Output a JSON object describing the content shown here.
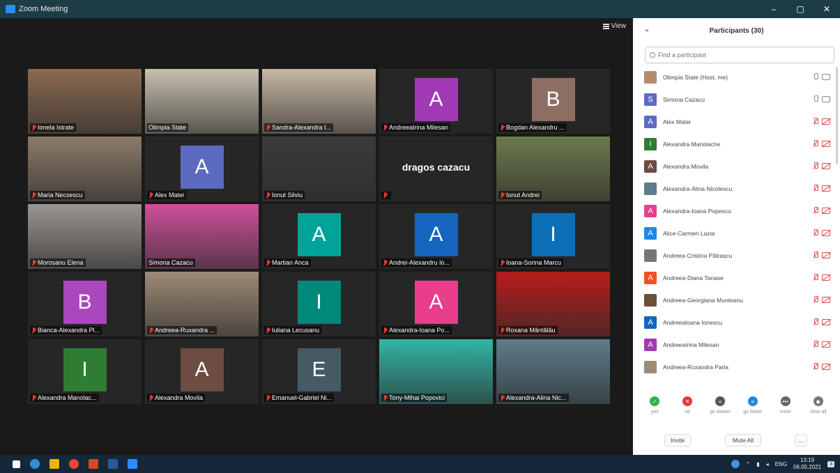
{
  "window": {
    "title": "Zoom Meeting",
    "minimize": "–",
    "maximize": "▢",
    "close": "✕"
  },
  "stage": {
    "view_label": "View"
  },
  "tiles": [
    {
      "name": "Ionela Istrate",
      "type": "video",
      "bg": "#8a6a52"
    },
    {
      "name": "Olimpia State",
      "type": "video",
      "bg": "#c9c1ae",
      "mic_on": true
    },
    {
      "name": "Sandra-Alexandra I...",
      "type": "video",
      "bg": "#c8b8a2"
    },
    {
      "name": "AndreeaIrina Milesan",
      "type": "avatar",
      "letter": "A",
      "color": "#a23ab5"
    },
    {
      "name": "Bogdan Alexandru ...",
      "type": "avatar",
      "letter": "B",
      "color": "#8d6e63"
    },
    {
      "name": "Maria Necsescu",
      "type": "video",
      "bg": "#8b7a6a"
    },
    {
      "name": "Alex Matei",
      "type": "avatar",
      "letter": "A",
      "color": "#5c6bc0"
    },
    {
      "name": "Ionut Silviu",
      "type": "video",
      "bg": "#3b3b3b"
    },
    {
      "name": "",
      "type": "text",
      "big_name": "dragos cazacu"
    },
    {
      "name": "Ionut Andrei",
      "type": "video",
      "bg": "#6d7a4c"
    },
    {
      "name": "Morosanu Elena",
      "type": "video",
      "bg": "#9a9590"
    },
    {
      "name": "Simona Cazacu",
      "type": "video",
      "bg": "#d04f9a",
      "active": true,
      "mic_on": true
    },
    {
      "name": "Martian Anca",
      "type": "avatar",
      "letter": "A",
      "color": "#00a39a"
    },
    {
      "name": "Andrei-Alexandru Io...",
      "type": "avatar",
      "letter": "A",
      "color": "#1565c0"
    },
    {
      "name": "Ioana-Sorina Marcu",
      "type": "avatar",
      "letter": "I",
      "color": "#0d6fb8"
    },
    {
      "name": "Bianca-Alexandra Pl...",
      "type": "avatar",
      "letter": "B",
      "color": "#ab47bc"
    },
    {
      "name": "Andreea-Ruxandra ...",
      "type": "video",
      "bg": "#9e8a76"
    },
    {
      "name": "Iuliana Lecusanu",
      "type": "avatar",
      "letter": "I",
      "color": "#00897b"
    },
    {
      "name": "Alexandra-Ioana Po...",
      "type": "avatar",
      "letter": "A",
      "color": "#e83e8c"
    },
    {
      "name": "Roxana Mântălău",
      "type": "video",
      "bg": "#b71c1c"
    },
    {
      "name": "Alexandra Manolac...",
      "type": "avatar",
      "letter": "I",
      "color": "#2e7d32"
    },
    {
      "name": "Alexandra Movila",
      "type": "avatar",
      "letter": "A",
      "color": "#6d4c41"
    },
    {
      "name": "Emanuel-Gabriel Ni...",
      "type": "avatar",
      "letter": "E",
      "color": "#455a64"
    },
    {
      "name": "Tony-Mihai Popovici",
      "type": "video",
      "bg": "#33b5a5"
    },
    {
      "name": "Alexandra-Alina Nic...",
      "type": "video",
      "bg": "#5f7d8c"
    }
  ],
  "panel": {
    "title": "Participants (30)",
    "collapse_icon": "⌄",
    "search_placeholder": "Find a participant",
    "participants": [
      {
        "name": "Olimpia State (Host, me)",
        "letter": "",
        "color": "#b88b6e",
        "muted": false
      },
      {
        "name": "Simona Cazacu",
        "letter": "S",
        "color": "#5c6bc0",
        "muted": false
      },
      {
        "name": "Alex Matei",
        "letter": "A",
        "color": "#5c6bc0",
        "muted": true
      },
      {
        "name": "Alexandra Manolache",
        "letter": "I",
        "color": "#2e7d32",
        "muted": true
      },
      {
        "name": "Alexandra Movila",
        "letter": "A",
        "color": "#6d4c41",
        "muted": true
      },
      {
        "name": "Alexandra-Alina Nicolescu",
        "letter": "",
        "color": "#5f7d8c",
        "muted": true
      },
      {
        "name": "Alexandra-Ioana Popescu",
        "letter": "A",
        "color": "#e83e8c",
        "muted": true
      },
      {
        "name": "Alice-Carmen Lazar",
        "letter": "A",
        "color": "#1e88e5",
        "muted": true
      },
      {
        "name": "Andreea Cristina Pătrașcu",
        "letter": "",
        "color": "#777777",
        "muted": true
      },
      {
        "name": "Andreea-Diana Tanase",
        "letter": "A",
        "color": "#f4511e",
        "muted": true
      },
      {
        "name": "Andreea-Georgiana Munteanu",
        "letter": "",
        "color": "#6a4f3b",
        "muted": true
      },
      {
        "name": "Andreealoana Ionescu",
        "letter": "A",
        "color": "#1565c0",
        "muted": true
      },
      {
        "name": "AndreeaIrina Milesan",
        "letter": "A",
        "color": "#a23ab5",
        "muted": true
      },
      {
        "name": "Andreea-Ruxandra Parla",
        "letter": "",
        "color": "#9e8a76",
        "muted": true
      }
    ],
    "reactions": [
      {
        "label": "yes",
        "symbol": "✓",
        "color": "#2eb24a"
      },
      {
        "label": "no",
        "symbol": "✕",
        "color": "#e53935"
      },
      {
        "label": "go slower",
        "symbol": "«",
        "color": "#555555"
      },
      {
        "label": "go faster",
        "symbol": "»",
        "color": "#1e88e5"
      },
      {
        "label": "more",
        "symbol": "•••",
        "color": "#666666"
      },
      {
        "label": "clear all",
        "symbol": "◆",
        "color": "#777777"
      }
    ],
    "invite_label": "Invite",
    "mute_all_label": "Mute All",
    "more_label": "..."
  },
  "taskbar": {
    "lang": "ENG",
    "time": "13:19",
    "date": "06.05.2021",
    "notifications": "3"
  }
}
